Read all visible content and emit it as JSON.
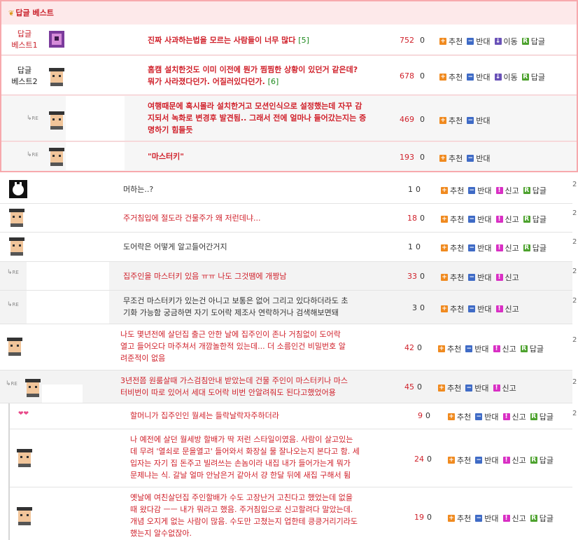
{
  "best_header": "답글 베스트",
  "best_rows": [
    {
      "label": "답글\n베스트1",
      "title": "진짜 사과하는법을 모르는 사람들이 너무 많다",
      "comments": "[5]",
      "count": "752",
      "zero": "0",
      "move": "이동"
    },
    {
      "label": "답글\n베스트2",
      "title": "홈캠 설치한것도 이미 이전에 뭔가 찜찜한 상황이 있던거 같은데?\n뭐가 사라졌다던가. 어질러있다던가.",
      "comments": "[6]",
      "count": "678",
      "zero": "0",
      "move": "이동"
    },
    {
      "re": "RE",
      "title": "여행때문에 혹시몰라 설치한거고 모션인식으로 설정했는데 자꾸 감\n지되서 녹화로 변경후 발견됨.. 그래서 전에 얼마나 들어갔는지는 증\n명하기 힘들듯",
      "count": "469",
      "zero": "0"
    },
    {
      "re": "RE",
      "title": "\"마스터키\"",
      "count": "193",
      "zero": "0"
    }
  ],
  "labels": {
    "up": "추천",
    "down": "반대",
    "report": "신고",
    "reply": "답글"
  },
  "rows": [
    {
      "title": "머하는..?",
      "count": "1",
      "zero": "0",
      "style": "dark",
      "report": true,
      "reply": true
    },
    {
      "title": "주거침입에 절도라 건물주가 왜 저런데냐...",
      "count": "18",
      "zero": "0",
      "style": "red",
      "report": true,
      "reply": true
    },
    {
      "title": "도어락은 어떻게 알고들어간거지",
      "count": "1",
      "zero": "0",
      "style": "dark",
      "report": true,
      "reply": true
    },
    {
      "re": "RE",
      "title": "집주인을 마스터키 있음 ㅠㅠ 나도 그것땜에 개짱남",
      "count": "33",
      "zero": "0",
      "style": "red",
      "report": true,
      "reply": false
    },
    {
      "re": "RE",
      "title": "무조건 마스터키가 있는건 아니고 보통은 없어 그리고 있다하더라도 초\n기화 가능함 궁금하면 자기 도어락 제조사 연락하거나 검색해보면돼",
      "count": "3",
      "zero": "0",
      "style": "dark",
      "report": true,
      "reply": false
    },
    {
      "title": "나도 몇년전에 살던집 출근 안한 날에 집주인이 존나 거침없이 도어락\n열고 들어오다 마주쳐서 개깜놀한적 있는데... 더 소름인건 비밀번호 알\n려준적이 없음",
      "count": "42",
      "zero": "0",
      "style": "red",
      "report": true,
      "reply": true
    },
    {
      "re": "RE",
      "title": "3년전쯤 원룸살때 가스검침안내 받았는데 건물 주인이 마스터키나 마스\n터비번이 따로 있어서 세대 도어락 비번 안알려줘도 된다고했었어용",
      "count": "45",
      "zero": "0",
      "style": "red",
      "report": true,
      "reply": false
    },
    {
      "title": "할머니가 집주인인 월세는 들락날락자주하더라",
      "count": "9",
      "zero": "0",
      "style": "red",
      "report": true,
      "reply": true
    },
    {
      "title": "나 예전에 살던 월세방 할배가 딱 저런 스타일이였음. 사람이 살고있는\n데 무려 '열쇠로 문을열고' 들어와서 화장실 물 잘나오는지 본다고 함. 세\n입자는 자기 집 돈주고 빌려쓰는 손놈이라 내집 내가 들어가는게 뭐가\n문제냐는 식. 갈날 얼마 안남은거 같아서 걍 한달 뒤에 새집 구해서 튐",
      "count": "24",
      "zero": "0",
      "style": "red",
      "report": true,
      "reply": true
    },
    {
      "title": "옛날에 여친살던집 주인할배가 수도 고장난거 고친다고 했었는데 없을\n때 왔다감 ㅡㅡ 내가 뭐라고 했음. 주거침입으로 신고할려다 말았는데.\n개념 오지게 없는 사람이 많음. 수도만 고쳤는지 업한테 킁킁거리기라도\n했는지 알수없잖아.",
      "count": "19",
      "zero": "0",
      "style": "red",
      "report": true,
      "reply": true
    }
  ],
  "edge_marks": [
    "2",
    "2",
    "2",
    "2",
    "2",
    "2",
    "2",
    "2"
  ]
}
